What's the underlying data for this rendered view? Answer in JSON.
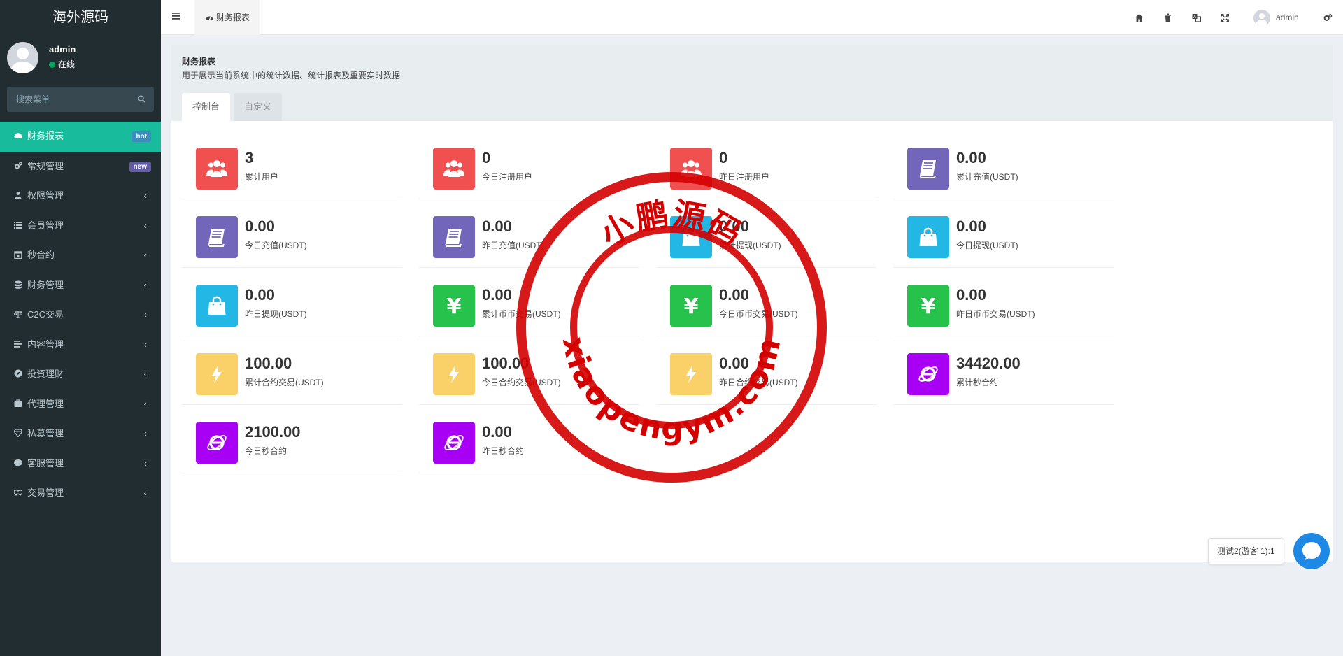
{
  "brand": "海外源码",
  "user": {
    "name": "admin",
    "status": "在线"
  },
  "search": {
    "placeholder": "搜索菜单"
  },
  "menu": [
    {
      "label": "财务报表",
      "icon": "dashboard-icon",
      "badge": "hot",
      "active": true
    },
    {
      "label": "常规管理",
      "icon": "cogs-icon",
      "badge": "new"
    },
    {
      "label": "权限管理",
      "icon": "group-icon",
      "chevron": "‹"
    },
    {
      "label": "会员管理",
      "icon": "list-icon",
      "chevron": "‹"
    },
    {
      "label": "秒合约",
      "icon": "calendar-icon",
      "chevron": "‹"
    },
    {
      "label": "财务管理",
      "icon": "database-icon",
      "chevron": "‹"
    },
    {
      "label": "C2C交易",
      "icon": "balance-icon",
      "chevron": "‹"
    },
    {
      "label": "内容管理",
      "icon": "align-icon",
      "chevron": "‹"
    },
    {
      "label": "投资理财",
      "icon": "compass-icon",
      "chevron": "‹"
    },
    {
      "label": "代理管理",
      "icon": "briefcase-icon",
      "chevron": "‹"
    },
    {
      "label": "私募管理",
      "icon": "diamond-icon",
      "chevron": "‹"
    },
    {
      "label": "客服管理",
      "icon": "comment-icon",
      "chevron": "‹"
    },
    {
      "label": "交易管理",
      "icon": "handshake-icon",
      "chevron": "‹"
    }
  ],
  "header": {
    "tab_label": "财务报表",
    "user_name": "admin",
    "tools": [
      "home-icon",
      "trash-icon",
      "translate-icon",
      "fullscreen-icon",
      "settings-icon"
    ]
  },
  "panel": {
    "title": "财务报表",
    "description": "用于展示当前系统中的统计数据、统计报表及重要实时数据",
    "tabs": [
      "控制台",
      "自定义"
    ]
  },
  "stats": [
    {
      "value": "3",
      "label": "累计用户",
      "color": "#f05050",
      "icon": "users-icon"
    },
    {
      "value": "0",
      "label": "今日注册用户",
      "color": "#f05050",
      "icon": "users-icon"
    },
    {
      "value": "0",
      "label": "昨日注册用户",
      "color": "#f05050",
      "icon": "users-icon"
    },
    {
      "value": "0.00",
      "label": "累计充值(USDT)",
      "color": "#7266ba",
      "icon": "book-icon"
    },
    {
      "value": "0.00",
      "label": "今日充值(USDT)",
      "color": "#7266ba",
      "icon": "book-icon"
    },
    {
      "value": "0.00",
      "label": "昨日充值(USDT)",
      "color": "#7266ba",
      "icon": "book-icon"
    },
    {
      "value": "0.00",
      "label": "累计提现(USDT)",
      "color": "#23b7e5",
      "icon": "shopping-bag-icon"
    },
    {
      "value": "0.00",
      "label": "今日提现(USDT)",
      "color": "#23b7e5",
      "icon": "shopping-bag-icon"
    },
    {
      "value": "0.00",
      "label": "昨日提现(USDT)",
      "color": "#23b7e5",
      "icon": "shopping-bag-icon"
    },
    {
      "value": "0.00",
      "label": "累计币币交易(USDT)",
      "color": "#27c24c",
      "icon": "yen-icon"
    },
    {
      "value": "0.00",
      "label": "今日币币交易(USDT)",
      "color": "#27c24c",
      "icon": "yen-icon"
    },
    {
      "value": "0.00",
      "label": "昨日币币交易(USDT)",
      "color": "#27c24c",
      "icon": "yen-icon"
    },
    {
      "value": "100.00",
      "label": "累计合约交易(USDT)",
      "color": "#fad069",
      "icon": "bolt-icon"
    },
    {
      "value": "100.00",
      "label": "今日合约交易(USDT)",
      "color": "#fad069",
      "icon": "bolt-icon"
    },
    {
      "value": "0.00",
      "label": "昨日合约交易(USDT)",
      "color": "#fad069",
      "icon": "bolt-icon"
    },
    {
      "value": "34420.00",
      "label": "累计秒合约",
      "color": "#a700f4",
      "icon": "internet-explorer-icon"
    },
    {
      "value": "2100.00",
      "label": "今日秒合约",
      "color": "#a700f4",
      "icon": "internet-explorer-icon"
    },
    {
      "value": "0.00",
      "label": "昨日秒合约",
      "color": "#a700f4",
      "icon": "internet-explorer-icon"
    }
  ],
  "watermark": {
    "top_text": "小鹏源码",
    "bottom_text": "xiaopengym.com",
    "color": "#d40000"
  },
  "chat": {
    "tip": "测试2(游客 1):1",
    "color": "#1e88e5"
  },
  "colors": {
    "sidebar": "#222d32",
    "accent": "#18bc9c"
  }
}
